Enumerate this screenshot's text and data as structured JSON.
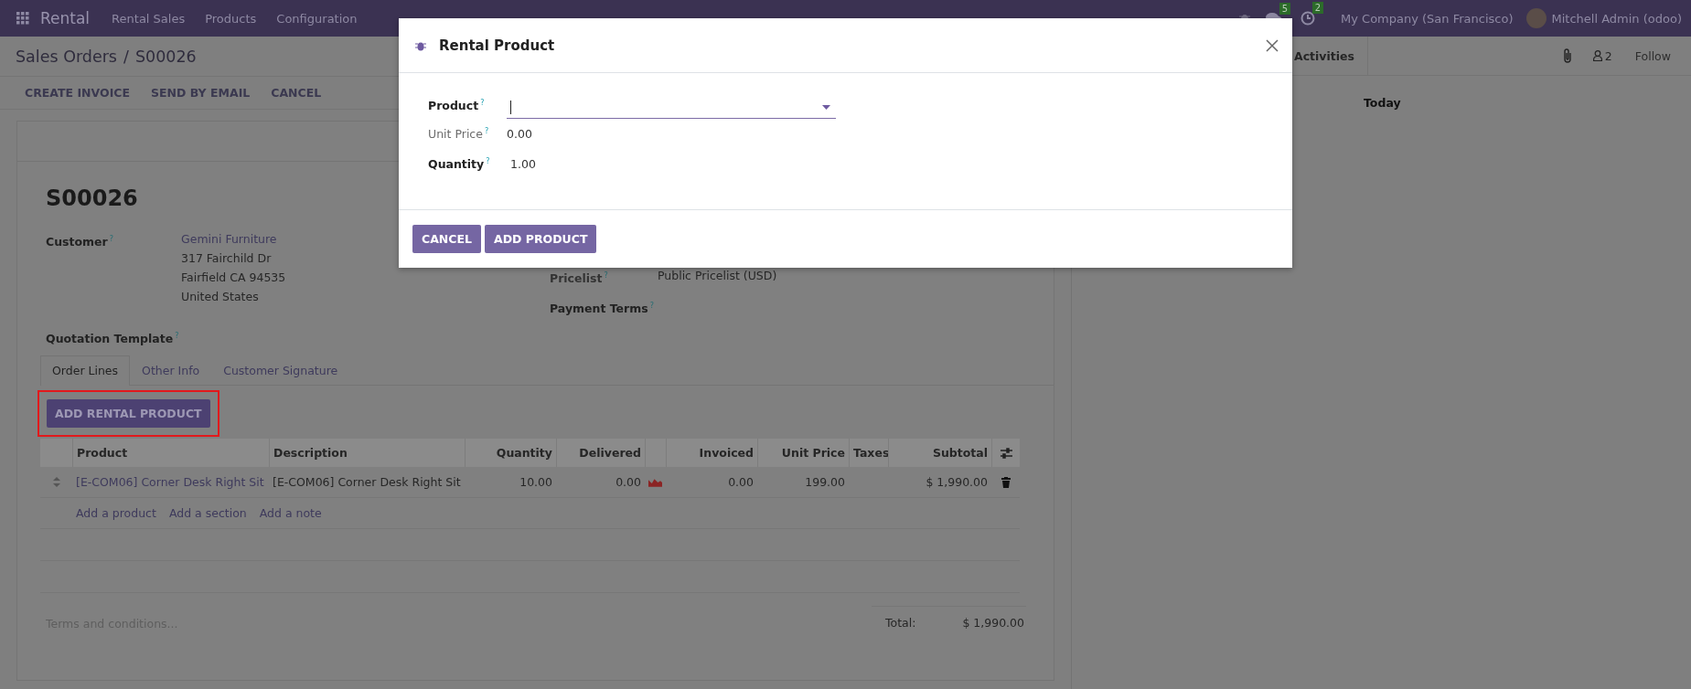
{
  "navbar": {
    "app_name": "Rental",
    "menu": [
      "Rental Sales",
      "Products",
      "Configuration"
    ],
    "messages_count": "5",
    "activities_count": "2",
    "company": "My Company (San Francisco)",
    "user": "Mitchell Admin (odoo)"
  },
  "breadcrumb": {
    "parent": "Sales Orders",
    "separator": "/",
    "current": "S00026"
  },
  "actions": [
    "CREATE INVOICE",
    "SEND BY EMAIL",
    "CANCEL"
  ],
  "form": {
    "name": "S00026",
    "customer_label": "Customer$^{?}$",
    "customer_name": "Gemini Furniture",
    "customer_address": [
      "317 Fairchild Dr",
      "Fairfield CA 94535",
      "United States"
    ],
    "quotation_template_label": "Quotation Template$^{?}$",
    "pricelist_label": "Pricelist$^{?}$",
    "pricelist_value": "Public Pricelist (USD)",
    "payment_terms_label": "Payment Terms$^{?}$"
  },
  "tabs": [
    {
      "label": "Order Lines",
      "selected": true
    },
    {
      "label": "Other Info",
      "selected": false
    },
    {
      "label": "Customer Signature",
      "selected": false
    }
  ],
  "add_rental_button": {
    "label": "ADD RENTAL PRODUCT",
    "highlighted": true
  },
  "table": {
    "columns": [
      {
        "label": "Product",
        "kind": "link"
      },
      {
        "label": "Description",
        "kind": "text"
      },
      {
        "label": "Quantity",
        "kind": "number"
      },
      {
        "label": "Delivered",
        "kind": "number"
      },
      {
        "kind": "chart"
      },
      {
        "label": "Invoiced",
        "kind": "number"
      },
      {
        "label": "Unit Price",
        "kind": "number"
      },
      {
        "label": "Taxes",
        "kind": "text"
      },
      {
        "label": "Subtotal",
        "kind": "number"
      }
    ],
    "rows": [
      {
        "cells": [
          "[E-COM06] Corner Desk Right Sit",
          "[E-COM06] Corner Desk Right Sit",
          "10.00",
          "0.00",
          null,
          "0.00",
          "199.00",
          null,
          "$ 1,990.00"
        ]
      }
    ],
    "add_links": [
      "Add a product",
      "Add a section",
      "Add a note"
    ]
  },
  "terms_placeholder": "Terms and conditions...",
  "total_label": "Total:",
  "total_value": "$ 1,990.00",
  "chatter": {
    "activities": "Activities",
    "followers": "2",
    "follow": "Follow",
    "date_separator": "Today"
  },
  "dialog": {
    "title": "Rental Product",
    "fields": [
      {
        "label": "Product$^{?}$",
        "kind": "dropdown",
        "readonly": false
      },
      {
        "label": "Unit Price$^{?}$",
        "kind": "text",
        "value": "0.00",
        "readonly": true
      },
      {
        "label": "Quantity$^{?}$",
        "kind": "text",
        "value": "1.00",
        "readonly": false
      }
    ],
    "buttons": [
      "CANCEL",
      "ADD PRODUCT"
    ]
  }
}
